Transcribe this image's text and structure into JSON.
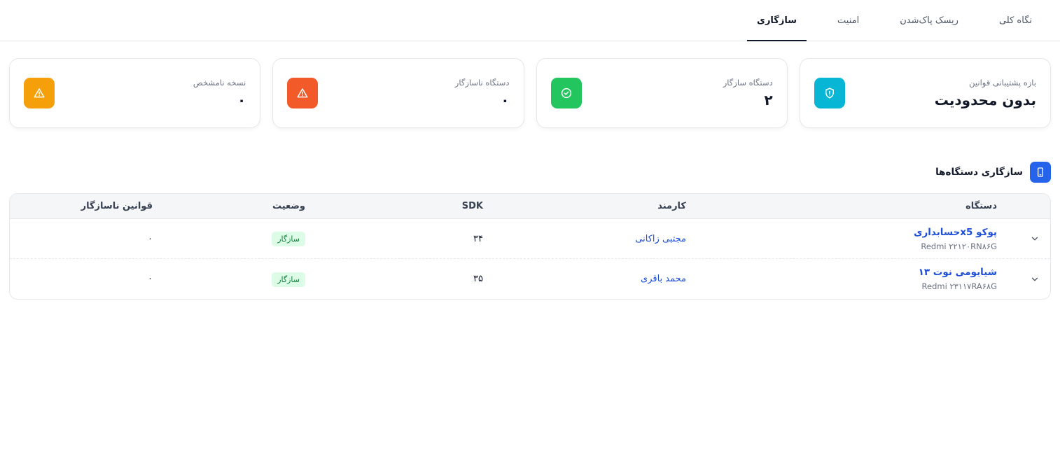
{
  "tabs": [
    {
      "label": "نگاه کلی",
      "active": false
    },
    {
      "label": "ریسک پاک‌شدن",
      "active": false
    },
    {
      "label": "امنیت",
      "active": false
    },
    {
      "label": "سازگاری",
      "active": true
    }
  ],
  "cards": [
    {
      "label": "بازه پشتیبانی قوانین",
      "value": "بدون محدودیت",
      "color": "#06b6d4",
      "icon": "shield-alert-icon"
    },
    {
      "label": "دستگاه سازگار",
      "value": "۲",
      "color": "#22c55e",
      "icon": "check-circle-icon"
    },
    {
      "label": "دستگاه ناسازگار",
      "value": "۰",
      "color": "#f25a2a",
      "icon": "warning-icon"
    },
    {
      "label": "نسخه نامشخص",
      "value": "۰",
      "color": "#f5a00b",
      "icon": "warning-icon"
    }
  ],
  "section": {
    "title": "سازگاری دستگاه‌ها",
    "icon": "smartphone-icon",
    "color": "#2563eb"
  },
  "table": {
    "headers": {
      "device": "دستگاه",
      "employee": "کارمند",
      "sdk": "SDK",
      "status": "وضعیت",
      "rules": "قوانین ناسازگار"
    },
    "rows": [
      {
        "device": "پوکو x5حسابداری",
        "model": "Redmi ۲۲۱۲۰RN۸۶G",
        "employee": "مجتبی زاکانی",
        "sdk": "۳۴",
        "status": "سازگار",
        "rules": "۰"
      },
      {
        "device": "شیایومی نوت ۱۳",
        "model": "Redmi ۲۳۱۱۷RA۶۸G",
        "employee": "محمد باقری",
        "sdk": "۳۵",
        "status": "سازگار",
        "rules": "۰"
      }
    ]
  }
}
